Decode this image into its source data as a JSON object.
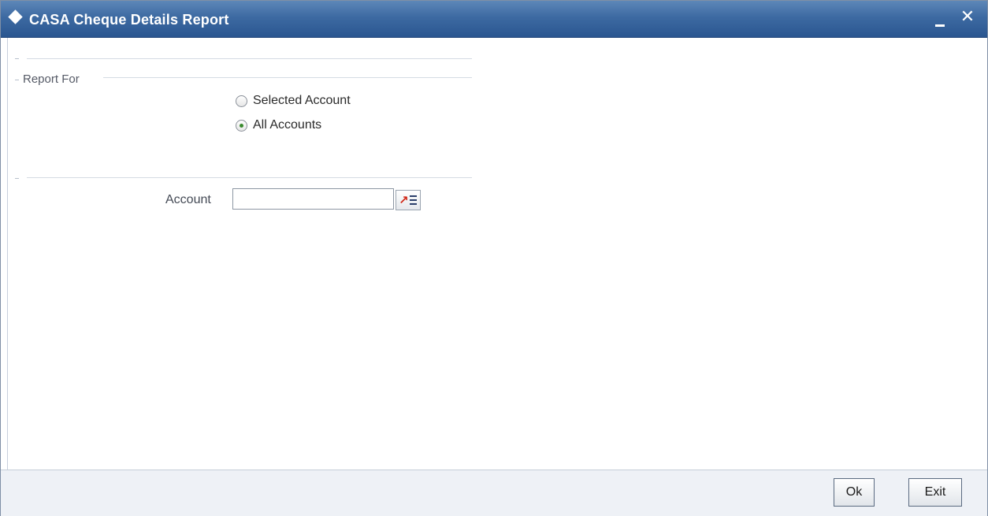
{
  "window": {
    "title": "CASA Cheque Details Report",
    "minimize_icon": "minimize-icon",
    "close_icon": "close-icon"
  },
  "report_for": {
    "legend": "Report For",
    "options": [
      {
        "label": "Selected Account",
        "checked": false
      },
      {
        "label": "All Accounts",
        "checked": true
      }
    ]
  },
  "account": {
    "label": "Account",
    "value": "",
    "lov_icon": "list-of-values-icon"
  },
  "footer": {
    "ok_label": "Ok",
    "exit_label": "Exit"
  }
}
